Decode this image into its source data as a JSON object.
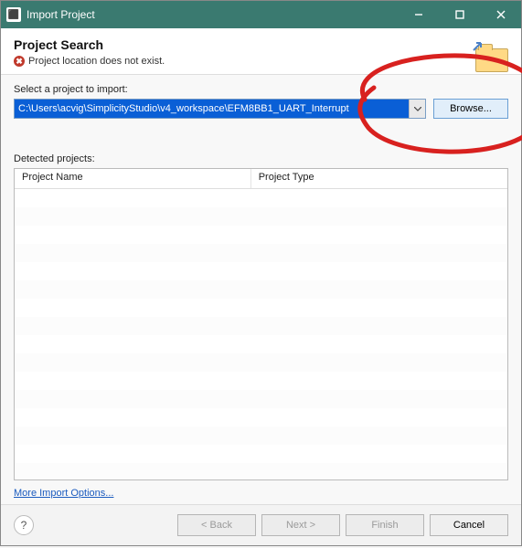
{
  "window": {
    "title": "Import Project"
  },
  "header": {
    "title": "Project Search",
    "error": "Project location does not exist."
  },
  "select": {
    "label": "Select a project to import:",
    "path": "C:\\Users\\acvig\\SimplicityStudio\\v4_workspace\\EFM8BB1_UART_Interrupt",
    "browse": "Browse..."
  },
  "detected": {
    "label": "Detected projects:",
    "columns": {
      "name": "Project Name",
      "type": "Project Type"
    },
    "rows": []
  },
  "link": {
    "more_options": "More Import Options..."
  },
  "footer": {
    "back": "< Back",
    "next": "Next >",
    "finish": "Finish",
    "cancel": "Cancel"
  }
}
